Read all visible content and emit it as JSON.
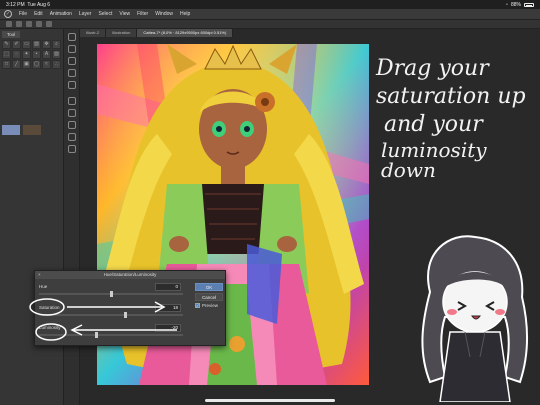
{
  "status_bar": {
    "time": "3:12 PM",
    "date": "Tue Aug 6",
    "battery": "88%"
  },
  "menu": {
    "items": [
      "File",
      "Edit",
      "Animation",
      "Layer",
      "Select",
      "View",
      "Filter",
      "Window",
      "Help"
    ]
  },
  "tool_panel": {
    "tab_label": "Tool"
  },
  "doc_tabs": [
    {
      "label": "Illustr-2"
    },
    {
      "label": "Illustration"
    },
    {
      "label": "Cattea-7* (8.0% · 8129x9500px 600dpi 0.51%)"
    }
  ],
  "annotation": {
    "line1": "Drag your",
    "line2": "saturation up",
    "line3": "and your",
    "line4": "luminosity down"
  },
  "dialog": {
    "title": "Hue/Saturation/Luminosity",
    "close": "×",
    "rows": [
      {
        "label": "Hue",
        "value": "0",
        "knob_fraction": 0.5
      },
      {
        "label": "Saturation",
        "value": "18",
        "knob_fraction": 0.6
      },
      {
        "label": "Luminosity",
        "value": "-20",
        "knob_fraction": 0.4
      }
    ],
    "ok_label": "OK",
    "cancel_label": "Cancel",
    "preview_label": "Preview",
    "preview_checked": true
  },
  "colors": {
    "accent": "#5a7fb0",
    "main_color": "#7a8db8",
    "sub_color": "#5a4a3a"
  }
}
